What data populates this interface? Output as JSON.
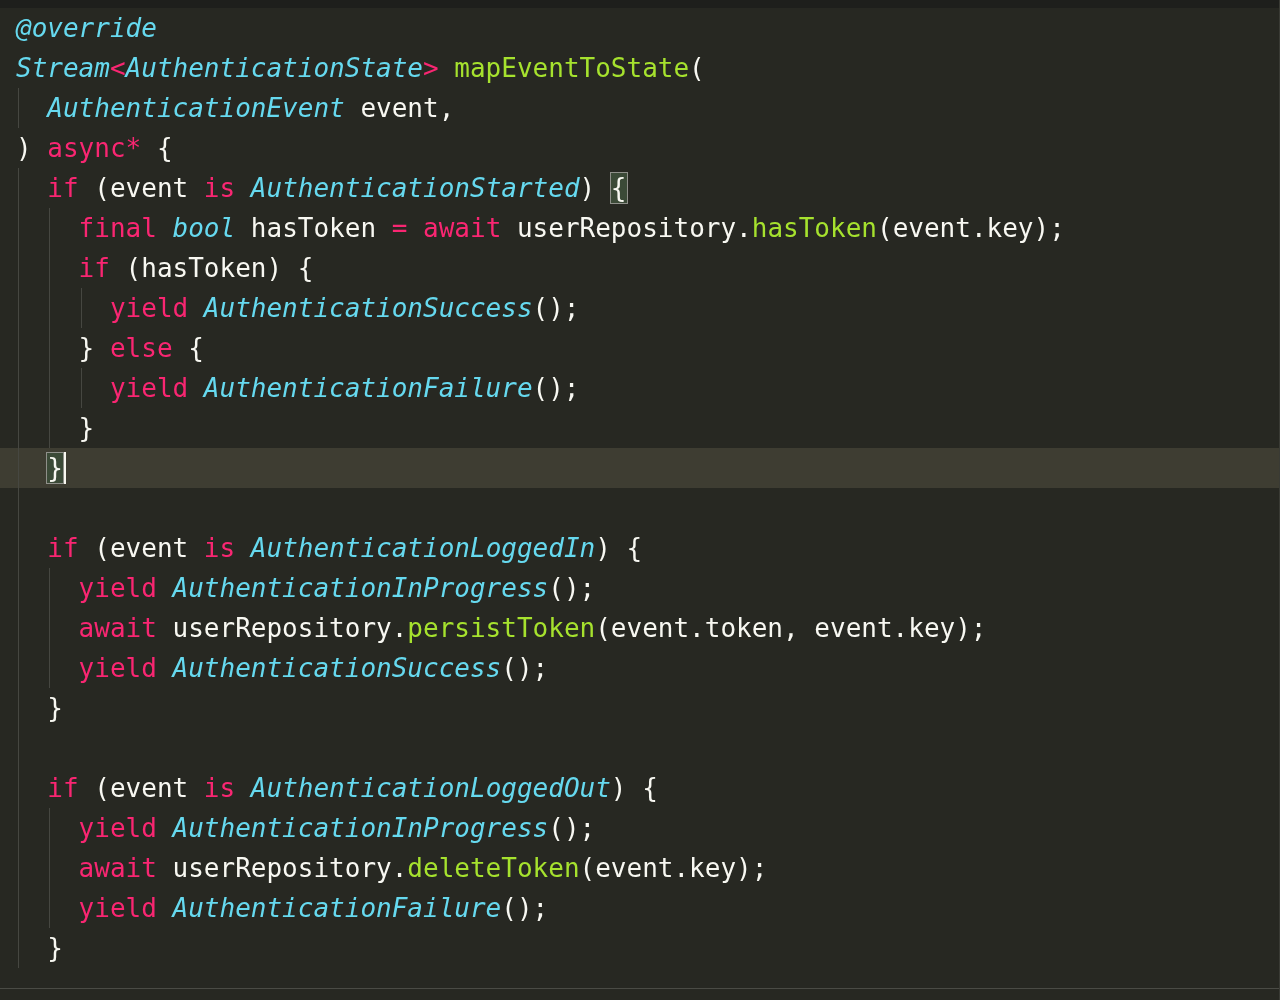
{
  "editor": {
    "lines": [
      {
        "kind": "code",
        "tokens": [
          {
            "text": "@override",
            "kind": "type"
          }
        ]
      },
      {
        "kind": "code",
        "tokens": [
          {
            "text": "Stream",
            "kind": "type"
          },
          {
            "text": "<",
            "kind": "keyword"
          },
          {
            "text": "AuthenticationState",
            "kind": "type"
          },
          {
            "text": ">",
            "kind": "keyword"
          },
          {
            "text": " mapEventToState",
            "kind": "function"
          },
          {
            "text": "(",
            "kind": "plain"
          }
        ]
      },
      {
        "kind": "code",
        "tokens": [
          {
            "text": "  AuthenticationEvent",
            "kind": "type"
          },
          {
            "text": " event,",
            "kind": "plain"
          }
        ]
      },
      {
        "kind": "code",
        "tokens": [
          {
            "text": ") ",
            "kind": "plain"
          },
          {
            "text": "async*",
            "kind": "keyword"
          },
          {
            "text": " {",
            "kind": "plain"
          }
        ]
      },
      {
        "kind": "code",
        "tokens": [
          {
            "text": "  if",
            "kind": "keyword"
          },
          {
            "text": " (event ",
            "kind": "plain"
          },
          {
            "text": "is",
            "kind": "keyword"
          },
          {
            "text": " AuthenticationStarted",
            "kind": "type"
          },
          {
            "text": ") ",
            "kind": "plain"
          },
          {
            "text": "{",
            "kind": "plain",
            "matched": true
          }
        ]
      },
      {
        "kind": "code",
        "tokens": [
          {
            "text": "    final",
            "kind": "keyword"
          },
          {
            "text": " bool",
            "kind": "type"
          },
          {
            "text": " hasToken ",
            "kind": "plain"
          },
          {
            "text": "=",
            "kind": "keyword"
          },
          {
            "text": " await",
            "kind": "keyword"
          },
          {
            "text": " userRepository.",
            "kind": "plain"
          },
          {
            "text": "hasToken",
            "kind": "function"
          },
          {
            "text": "(event.key);",
            "kind": "plain"
          }
        ]
      },
      {
        "kind": "code",
        "tokens": [
          {
            "text": "    if",
            "kind": "keyword"
          },
          {
            "text": " (hasToken) {",
            "kind": "plain"
          }
        ]
      },
      {
        "kind": "code",
        "tokens": [
          {
            "text": "      yield",
            "kind": "keyword"
          },
          {
            "text": " AuthenticationSuccess",
            "kind": "type"
          },
          {
            "text": "();",
            "kind": "plain"
          }
        ]
      },
      {
        "kind": "code",
        "tokens": [
          {
            "text": "    } ",
            "kind": "plain"
          },
          {
            "text": "else",
            "kind": "keyword"
          },
          {
            "text": " {",
            "kind": "plain"
          }
        ]
      },
      {
        "kind": "code",
        "tokens": [
          {
            "text": "      yield",
            "kind": "keyword"
          },
          {
            "text": " AuthenticationFailure",
            "kind": "type"
          },
          {
            "text": "();",
            "kind": "plain"
          }
        ]
      },
      {
        "kind": "code",
        "tokens": [
          {
            "text": "    }",
            "kind": "plain"
          }
        ]
      },
      {
        "kind": "code",
        "current": true,
        "cursor": true,
        "tokens": [
          {
            "text": "  }",
            "kind": "plain",
            "matched": true
          }
        ]
      },
      {
        "kind": "blank"
      },
      {
        "kind": "code",
        "tokens": [
          {
            "text": "  if",
            "kind": "keyword"
          },
          {
            "text": " (event ",
            "kind": "plain"
          },
          {
            "text": "is",
            "kind": "keyword"
          },
          {
            "text": " AuthenticationLoggedIn",
            "kind": "type"
          },
          {
            "text": ") {",
            "kind": "plain"
          }
        ]
      },
      {
        "kind": "code",
        "tokens": [
          {
            "text": "    yield",
            "kind": "keyword"
          },
          {
            "text": " AuthenticationInProgress",
            "kind": "type"
          },
          {
            "text": "();",
            "kind": "plain"
          }
        ]
      },
      {
        "kind": "code",
        "tokens": [
          {
            "text": "    await",
            "kind": "keyword"
          },
          {
            "text": " userRepository.",
            "kind": "plain"
          },
          {
            "text": "persistToken",
            "kind": "function"
          },
          {
            "text": "(event.token, event.key);",
            "kind": "plain"
          }
        ]
      },
      {
        "kind": "code",
        "tokens": [
          {
            "text": "    yield",
            "kind": "keyword"
          },
          {
            "text": " AuthenticationSuccess",
            "kind": "type"
          },
          {
            "text": "();",
            "kind": "plain"
          }
        ]
      },
      {
        "kind": "code",
        "tokens": [
          {
            "text": "  }",
            "kind": "plain"
          }
        ]
      },
      {
        "kind": "blank"
      },
      {
        "kind": "code",
        "tokens": [
          {
            "text": "  if",
            "kind": "keyword"
          },
          {
            "text": " (event ",
            "kind": "plain"
          },
          {
            "text": "is",
            "kind": "keyword"
          },
          {
            "text": " AuthenticationLoggedOut",
            "kind": "type"
          },
          {
            "text": ") {",
            "kind": "plain"
          }
        ]
      },
      {
        "kind": "code",
        "tokens": [
          {
            "text": "    yield",
            "kind": "keyword"
          },
          {
            "text": " AuthenticationInProgress",
            "kind": "type"
          },
          {
            "text": "();",
            "kind": "plain"
          }
        ]
      },
      {
        "kind": "code",
        "tokens": [
          {
            "text": "    await",
            "kind": "keyword"
          },
          {
            "text": " userRepository.",
            "kind": "plain"
          },
          {
            "text": "deleteToken",
            "kind": "function"
          },
          {
            "text": "(event.key);",
            "kind": "plain"
          }
        ]
      },
      {
        "kind": "code",
        "tokens": [
          {
            "text": "    yield",
            "kind": "keyword"
          },
          {
            "text": " AuthenticationFailure",
            "kind": "type"
          },
          {
            "text": "();",
            "kind": "plain"
          }
        ]
      },
      {
        "kind": "code",
        "tokens": [
          {
            "text": "  }",
            "kind": "plain"
          }
        ]
      }
    ]
  }
}
